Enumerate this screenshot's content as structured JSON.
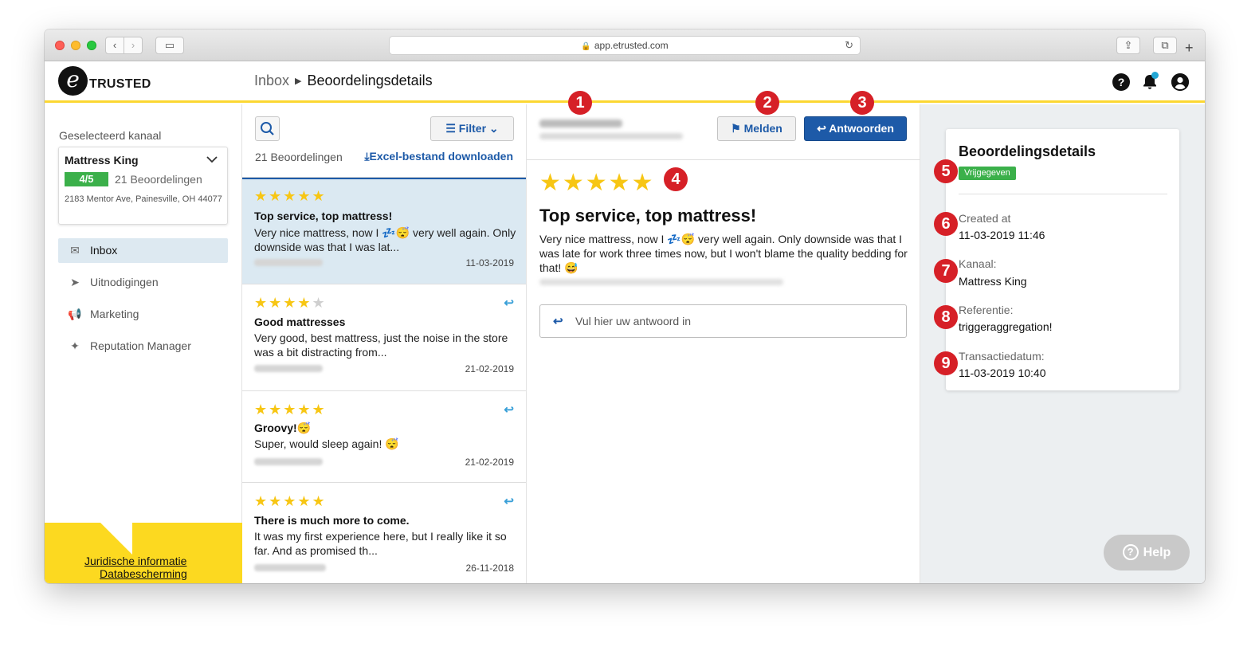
{
  "browser": {
    "url": "app.etrusted.com"
  },
  "header": {
    "logo_text": "TRUSTED",
    "logo_letter": "e",
    "breadcrumb_link": "Inbox",
    "breadcrumb_current": "Beoordelingsdetails",
    "icons": [
      "help-icon",
      "bell-icon",
      "user-icon"
    ]
  },
  "sidebar": {
    "selected_label": "Geselecteerd kanaal",
    "channel": {
      "name": "Mattress King",
      "score": "4/5",
      "count": "21 Beoordelingen",
      "address": "2183 Mentor Ave, Painesville, OH 44077"
    },
    "nav": [
      {
        "label": "Inbox",
        "icon": "inbox-icon",
        "active": true
      },
      {
        "label": "Uitnodigingen",
        "icon": "send-icon",
        "active": false
      },
      {
        "label": "Marketing",
        "icon": "megaphone-icon",
        "active": false
      },
      {
        "label": "Reputation Manager",
        "icon": "sparkle-icon",
        "active": false
      }
    ],
    "legal_link": "Juridische informatie",
    "privacy_link": "Databescherming"
  },
  "list": {
    "filter_label": "Filter",
    "count_label": "21 Beoordelingen",
    "excel_label": "Excel-bestand downloaden",
    "reviews": [
      {
        "stars": 5,
        "title": "Top service, top mattress!",
        "text": "Very nice mattress, now I 💤😴 very well again. Only downside was that I was lat...",
        "date": "11-03-2019",
        "replied": false
      },
      {
        "stars": 4,
        "title": "Good mattresses",
        "text": "Very good, best mattress, just the noise in the store was a bit distracting from...",
        "date": "21-02-2019",
        "replied": true
      },
      {
        "stars": 5,
        "title": "Groovy!😴",
        "text": "Super, would sleep again! 😴",
        "date": "21-02-2019",
        "replied": true
      },
      {
        "stars": 5,
        "title": "There is much more to come.",
        "text": "It was my first experience here, but I really like it so far. And as promised th...",
        "date": "26-11-2018",
        "replied": true
      }
    ]
  },
  "detail": {
    "melden_label": "Melden",
    "antwoorden_label": "Antwoorden",
    "stars": 5,
    "title": "Top service, top mattress!",
    "text": "Very nice mattress, now I 💤😴 very well again. Only downside was that I was late for work three times now, but I won't blame the quality bedding for that! 😅",
    "reply_placeholder": "Vul hier uw antwoord in"
  },
  "info": {
    "title": "Beoordelingsdetails",
    "status": "Vrijgegeven",
    "created_label": "Created at",
    "created_value": "11-03-2019 11:46",
    "kanaal_label": "Kanaal:",
    "kanaal_value": "Mattress King",
    "referentie_label": "Referentie:",
    "referentie_value": "triggeraggregation!",
    "transactie_label": "Transactiedatum:",
    "transactie_value": "11-03-2019 10:40",
    "help_label": "Help"
  },
  "markers": [
    "1",
    "2",
    "3",
    "4",
    "5",
    "6",
    "7",
    "8",
    "9"
  ],
  "colors": {
    "accent_yellow": "#fcd732",
    "primary_blue": "#1d5aa8",
    "status_green": "#3bb04a",
    "marker_red": "#d62027",
    "star_gold": "#f7c614"
  }
}
